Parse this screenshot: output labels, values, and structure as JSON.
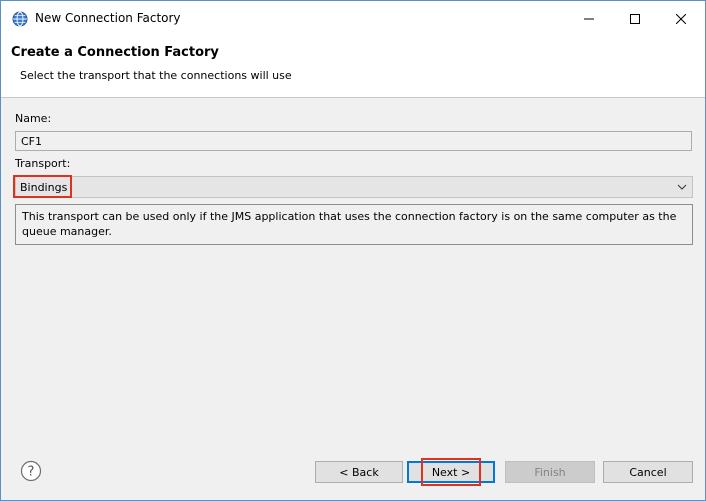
{
  "window": {
    "title": "New Connection Factory"
  },
  "banner": {
    "title": "Create a Connection Factory",
    "description": "Select the transport that the connections will use"
  },
  "form": {
    "name_label": "Name:",
    "name_value": "CF1",
    "transport_label": "Transport:",
    "transport_value": "Bindings",
    "transport_description": "This transport can be used only if the JMS application that uses the connection factory is on the same computer as the queue manager."
  },
  "buttons": {
    "back": "< Back",
    "next": "Next >",
    "finish": "Finish",
    "cancel": "Cancel"
  },
  "icons": {
    "app": "globe-icon",
    "help": "help-icon",
    "minimize": "minimize-icon",
    "maximize": "maximize-icon",
    "close": "close-icon",
    "dropdown": "chevron-down-icon"
  },
  "colors": {
    "highlight": "#e0301e",
    "focus": "#0078d7"
  }
}
